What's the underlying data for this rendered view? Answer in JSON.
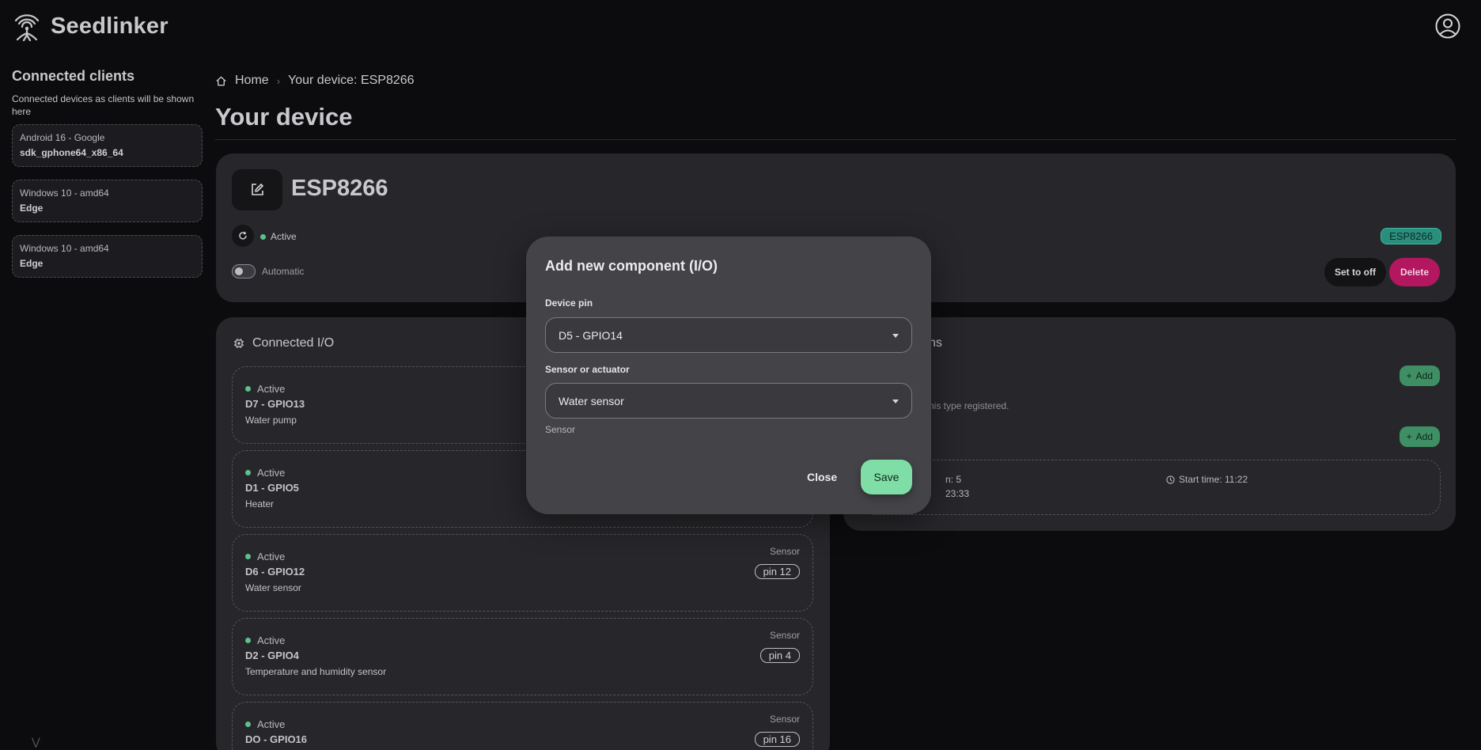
{
  "app": {
    "name": "Seedlinker"
  },
  "sidebar": {
    "title": "Connected clients",
    "hint": "Connected devices as clients will be shown here",
    "clients": [
      {
        "os": "Android 16 - Google",
        "name": "sdk_gphone64_x86_64"
      },
      {
        "os": "Windows 10 - amd64",
        "name": "Edge"
      },
      {
        "os": "Windows 10 - amd64",
        "name": "Edge"
      }
    ]
  },
  "breadcrumb": {
    "home": "Home",
    "current": "Your device: ESP8266"
  },
  "page": {
    "title": "Your device"
  },
  "device": {
    "name": "ESP8266",
    "status": "Active",
    "mode_label": "Automatic",
    "chip": "ESP8266",
    "set_off_label": "Set to off",
    "delete_label": "Delete"
  },
  "io": {
    "title": "Connected I/O",
    "items": [
      {
        "status": "Active",
        "pin": "D7 - GPIO13",
        "desc": "Water pump",
        "kind": "",
        "badge": ""
      },
      {
        "status": "Active",
        "pin": "D1 - GPIO5",
        "desc": "Heater",
        "kind": "",
        "badge": ""
      },
      {
        "status": "Active",
        "pin": "D6 - GPIO12",
        "desc": "Water sensor",
        "kind": "Sensor",
        "badge": "pin 12"
      },
      {
        "status": "Active",
        "pin": "D2 - GPIO4",
        "desc": "Temperature and humidity sensor",
        "kind": "Sensor",
        "badge": "pin 4"
      },
      {
        "status": "Active",
        "pin": "DO - GPIO16",
        "desc": "",
        "kind": "Sensor",
        "badge": "pin 16"
      }
    ]
  },
  "actions": {
    "title_partial": "ns",
    "add_label": "Add",
    "empty_partial": "his type registered.",
    "schedule": {
      "line1_partial": "n: 5",
      "line2_partial": "23:33",
      "start": "Start time: 11:22"
    }
  },
  "modal": {
    "title": "Add new component (I/O)",
    "pin_label": "Device pin",
    "pin_value": "D5 - GPIO14",
    "type_label": "Sensor or actuator",
    "type_value": "Water sensor",
    "type_helper": "Sensor",
    "close_label": "Close",
    "save_label": "Save"
  },
  "colors": {
    "accent": "#7fdea5",
    "danger": "#b3175f",
    "status_active": "#5fc08a",
    "chip": "#2a8e7c"
  },
  "icons": [
    "seedlinker-logo-icon",
    "account-icon",
    "home-icon",
    "edit-icon",
    "refresh-icon",
    "chip-icon",
    "plus-icon",
    "clock-icon",
    "chevron-down-icon"
  ]
}
